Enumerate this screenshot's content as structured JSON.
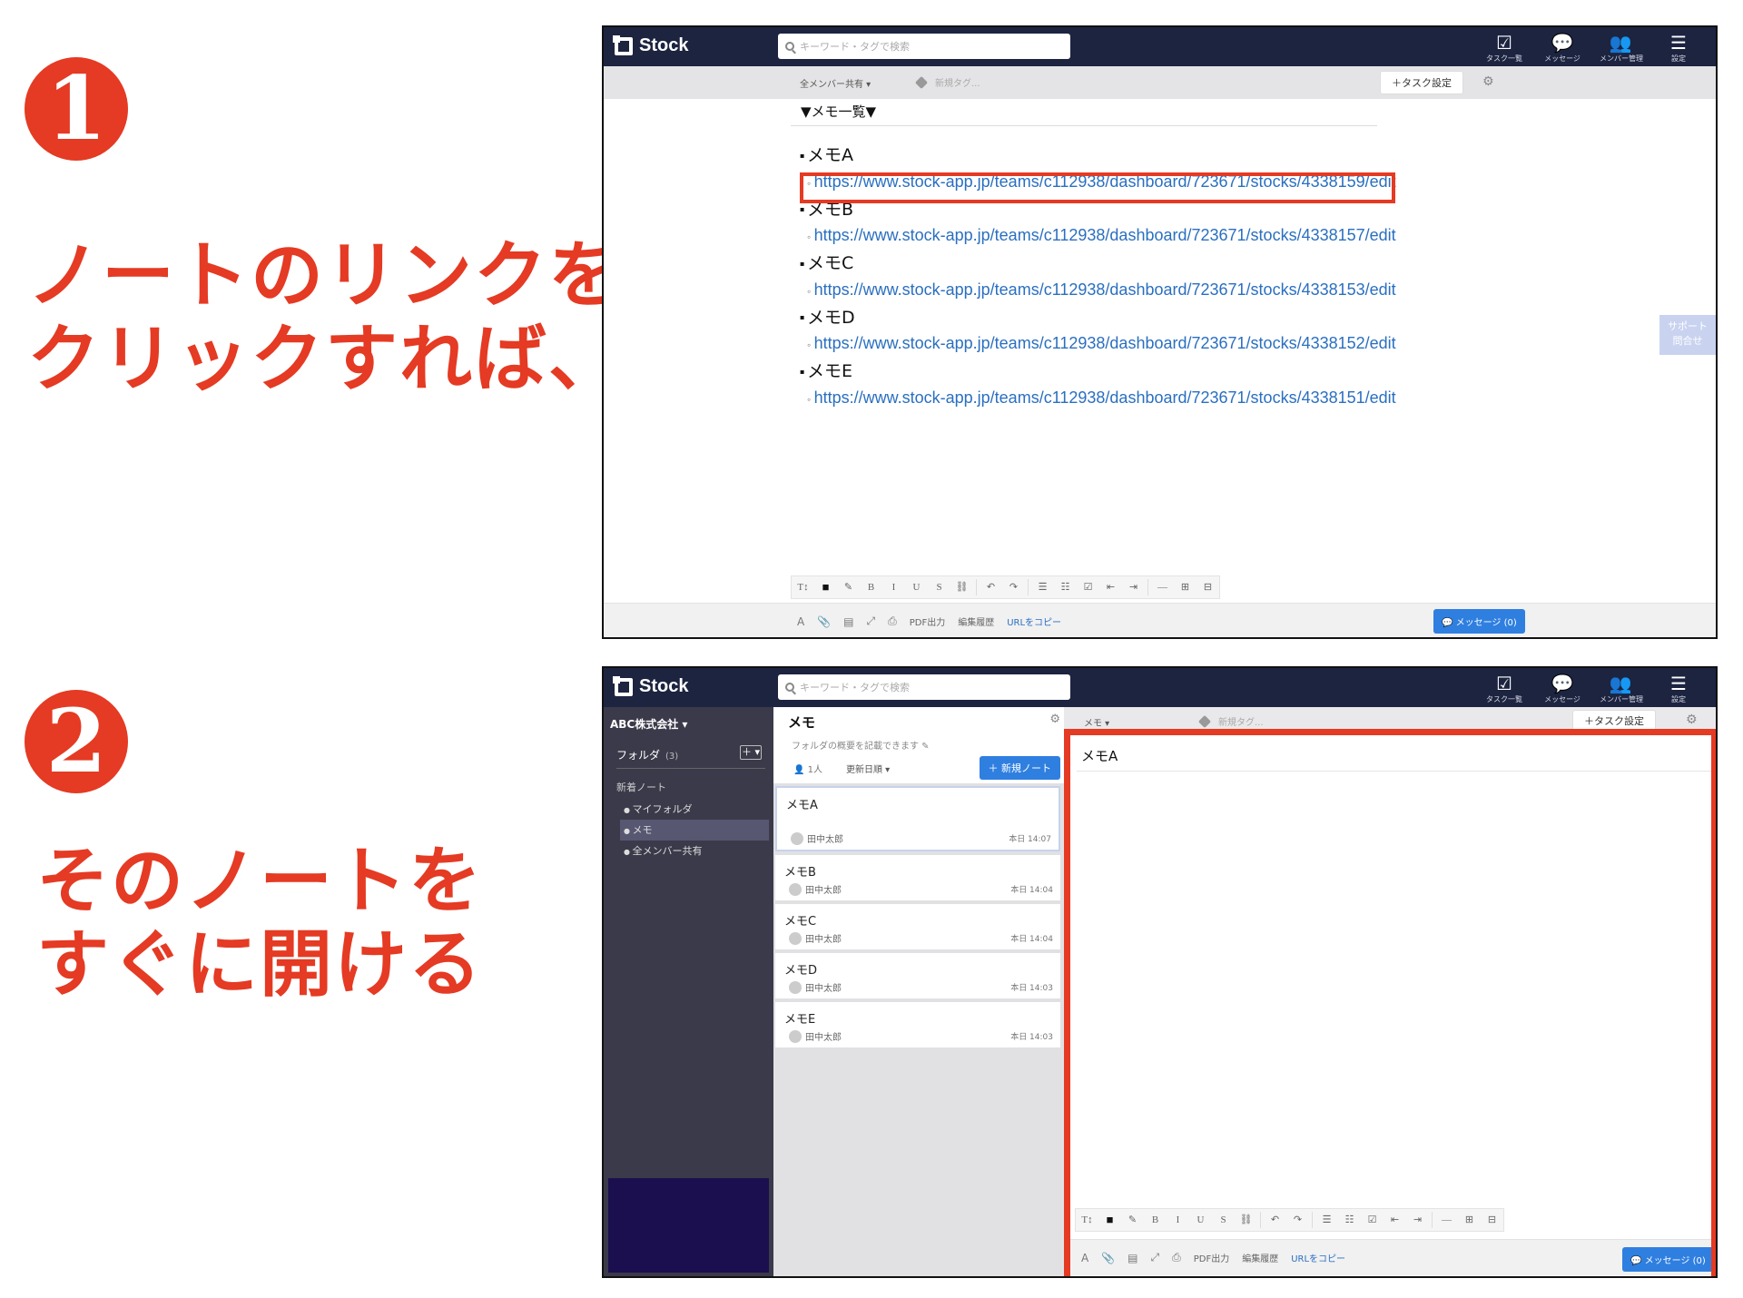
{
  "step1": {
    "number": "1",
    "caption_lines": [
      "ノートのリンクを",
      "クリックすれば、"
    ]
  },
  "step2": {
    "number": "2",
    "caption_lines": [
      "そのノートを",
      "すぐに開ける"
    ]
  },
  "app": {
    "logo": "Stock",
    "search_placeholder": "キーワード・タグで検索",
    "nav": [
      {
        "icon": "checkbox-icon",
        "glyph": "☑",
        "label": "タスク一覧"
      },
      {
        "icon": "chat-bubble-icon",
        "glyph": "💬",
        "label": "メッセージ"
      },
      {
        "icon": "members-icon",
        "glyph": "👥",
        "label": "メンバー管理"
      },
      {
        "icon": "menu-icon",
        "glyph": "☰",
        "label": "設定"
      }
    ],
    "task_settings": "＋タスク設定",
    "support": [
      "サポート",
      "問合せ"
    ]
  },
  "screen1": {
    "share_filter": "全メンバー共有 ▾",
    "tag_placeholder": "新規タグ...",
    "memo_heading": "▼メモ一覧▼",
    "memos": [
      {
        "title": "メモA",
        "url": "https://www.stock-app.jp/teams/c112938/dashboard/723671/stocks/4338159/edit"
      },
      {
        "title": "メモB",
        "url": "https://www.stock-app.jp/teams/c112938/dashboard/723671/stocks/4338157/edit"
      },
      {
        "title": "メモC",
        "url": "https://www.stock-app.jp/teams/c112938/dashboard/723671/stocks/4338153/edit"
      },
      {
        "title": "メモD",
        "url": "https://www.stock-app.jp/teams/c112938/dashboard/723671/stocks/4338152/edit"
      },
      {
        "title": "メモE",
        "url": "https://www.stock-app.jp/teams/c112938/dashboard/723671/stocks/4338151/edit"
      }
    ]
  },
  "toolbar": {
    "buttons": [
      "T↕",
      "■",
      "✎",
      "B",
      "I",
      "U",
      "S",
      "⛓",
      "↶",
      "↷",
      "☰",
      "☷",
      "☑",
      "⇤",
      "⇥",
      "—",
      "⊞",
      "⊟"
    ]
  },
  "bottombar": {
    "font": "A",
    "attach": "📎",
    "save": "▤",
    "expand": "⤢",
    "print": "⎙",
    "pdf": "PDF出力",
    "history": "編集履歴",
    "copy_url": "URLをコピー",
    "message": "💬 メッセージ (0)"
  },
  "screen2": {
    "org": "ABC株式会社 ▾",
    "folder_label": "フォルダ",
    "folder_count": "(3)",
    "folder_add": "＋ ▾",
    "new_note_label": "新着ノート",
    "folders": [
      "マイフォルダ",
      "メモ",
      "全メンバー共有"
    ],
    "current_folder": "メモ",
    "folder_desc": "フォルダの概要を記載できます ✎",
    "member_count": "👤 1人",
    "sort": "更新日順 ▾",
    "new_note_btn": "＋ 新規ノート",
    "notes": [
      {
        "title": "メモA",
        "author": "田中太郎",
        "time": "本日 14:07"
      },
      {
        "title": "メモB",
        "author": "田中太郎",
        "time": "本日 14:04"
      },
      {
        "title": "メモC",
        "author": "田中太郎",
        "time": "本日 14:04"
      },
      {
        "title": "メモD",
        "author": "田中太郎",
        "time": "本日 14:03"
      },
      {
        "title": "メモE",
        "author": "田中太郎",
        "time": "本日 14:03"
      }
    ],
    "editor_filter": "メモ ▾",
    "editor_tag": "新規タグ...",
    "open_note_title": "メモA"
  }
}
